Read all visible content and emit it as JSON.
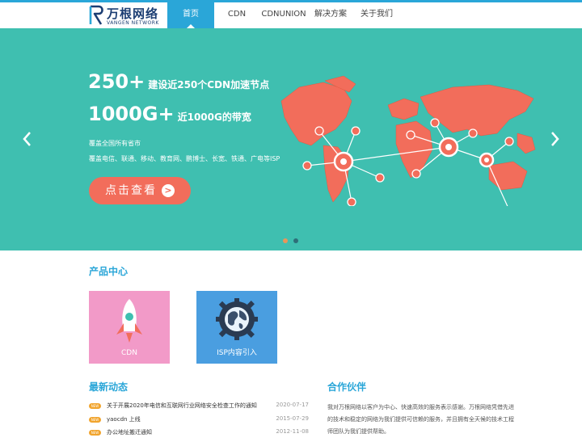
{
  "header": {
    "logo_cn": "万根网络",
    "logo_en": "VANGEN NETWORK",
    "nav": [
      {
        "label": "首页",
        "active": true
      },
      {
        "label": "CDN",
        "active": false
      },
      {
        "label": "CDNUNION",
        "active": false
      },
      {
        "label": "解决方案",
        "active": false
      },
      {
        "label": "关于我们",
        "active": false
      }
    ]
  },
  "banner": {
    "stat1_num": "250+",
    "stat1_text": "建设近250个CDN加速节点",
    "stat2_num": "1000G+",
    "stat2_text": "近1000G的带宽",
    "coverage_line1": "覆盖全国所有省市",
    "coverage_line2": "覆盖电信、联通、移动、教育网、鹏博士、长宽、铁通、广电等ISP",
    "cta_label": "点击查看",
    "cta_icon": ">",
    "prev_icon": "chevron-left-icon",
    "next_icon": "chevron-right-icon",
    "slides": [
      {
        "active": true
      },
      {
        "active": false
      }
    ],
    "colors": {
      "background": "#3fbfb0",
      "map": "#f26d5b",
      "cta": "#f26d5b"
    }
  },
  "products": {
    "title": "产品中心",
    "items": [
      {
        "label": "CDN",
        "icon": "rocket-icon",
        "color": "#f29ac8"
      },
      {
        "label": "ISP内容引入",
        "icon": "globe-gear-icon",
        "color": "#4a9ee0"
      }
    ]
  },
  "news": {
    "title": "最新动态",
    "items": [
      {
        "badge": "NEW",
        "title": "关于开展2020年电信和互联网行业网络安全检查工作的通知",
        "date": "2020-07-17"
      },
      {
        "badge": "NEW",
        "title": "yaocdn 上线",
        "date": "2015-07-29"
      },
      {
        "badge": "NEW",
        "title": "办公地址搬迁通知",
        "date": "2012-11-08"
      }
    ]
  },
  "partners": {
    "title": "合作伙伴",
    "text": "我对万根网络以客户为中心、快速高效的服务表示感谢。万根网络凭借先进的技术和稳定的网络为我们提供可信赖的服务，并且拥有全天候的技术工程师团队为我们提供帮助。"
  },
  "accent": "#2aa6d8"
}
